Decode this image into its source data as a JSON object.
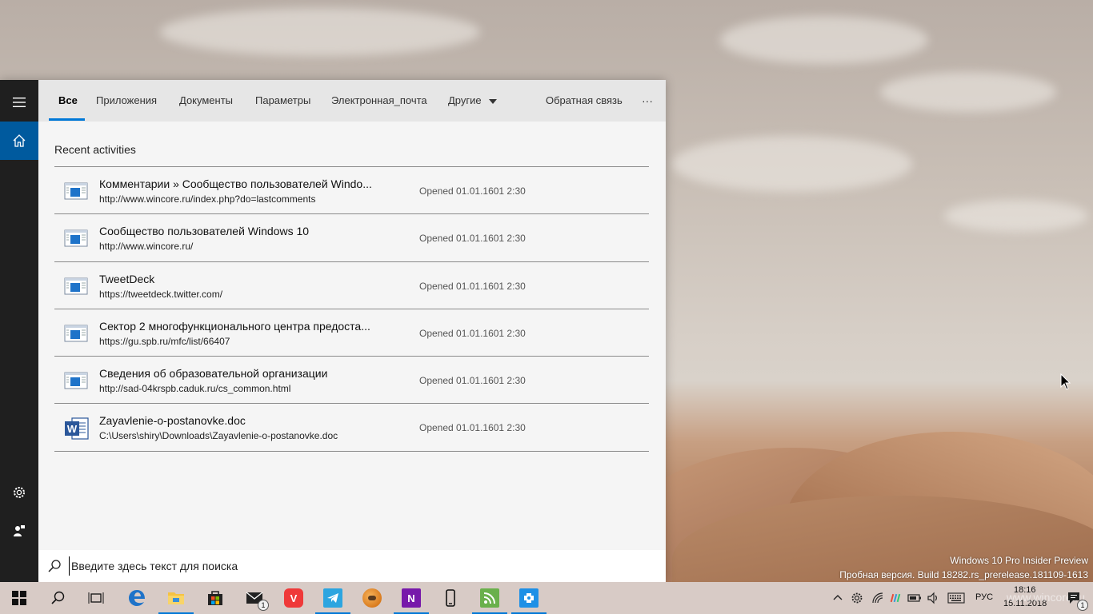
{
  "tabs": {
    "all": "Все",
    "apps": "Приложения",
    "documents": "Документы",
    "settings": "Параметры",
    "email": "Электронная_почта",
    "more": "Другие",
    "feedback": "Обратная связь",
    "options": "···"
  },
  "section_title": "Recent activities",
  "items": [
    {
      "title": "Комментарии » Сообщество пользователей Windo...",
      "sub": "http://www.wincore.ru/index.php?do=lastcomments",
      "meta": "Opened 01.01.1601 2:30",
      "icon": "web-page-icon"
    },
    {
      "title": "Сообщество пользователей Windows 10",
      "sub": "http://www.wincore.ru/",
      "meta": "Opened 01.01.1601 2:30",
      "icon": "web-page-icon"
    },
    {
      "title": "TweetDeck",
      "sub": "https://tweetdeck.twitter.com/",
      "meta": "Opened 01.01.1601 2:30",
      "icon": "web-page-icon"
    },
    {
      "title": "Сектор 2 многофункционального центра предоста...",
      "sub": "https://gu.spb.ru/mfc/list/66407",
      "meta": "Opened 01.01.1601 2:30",
      "icon": "web-page-icon"
    },
    {
      "title": "Сведения об образовательной организации",
      "sub": "http://sad-04krspb.caduk.ru/cs_common.html",
      "meta": "Opened 01.01.1601 2:30",
      "icon": "web-page-icon"
    },
    {
      "title": "Zayavlenie-o-postanovke.doc",
      "sub": "C:\\Users\\shiry\\Downloads\\Zayavlenie-o-postanovke.doc",
      "meta": "Opened 01.01.1601 2:30",
      "icon": "word-doc-icon"
    }
  ],
  "search": {
    "placeholder": "Введите здесь текст для поиска"
  },
  "watermark": {
    "line1": "Windows 10 Pro Insider Preview",
    "line2": "Пробная версия. Build 18282.rs_prerelease.181109-1613"
  },
  "taskbar": {
    "mail_badge": "1",
    "lang": "РУС",
    "time": "18:16",
    "date": "15.11.2018",
    "notif_badge": "1",
    "site_watermark": "www.wincore.ru"
  },
  "colors": {
    "accent": "#0078d7",
    "rail": "#1f1f1f",
    "rail_active": "#005a9e"
  }
}
